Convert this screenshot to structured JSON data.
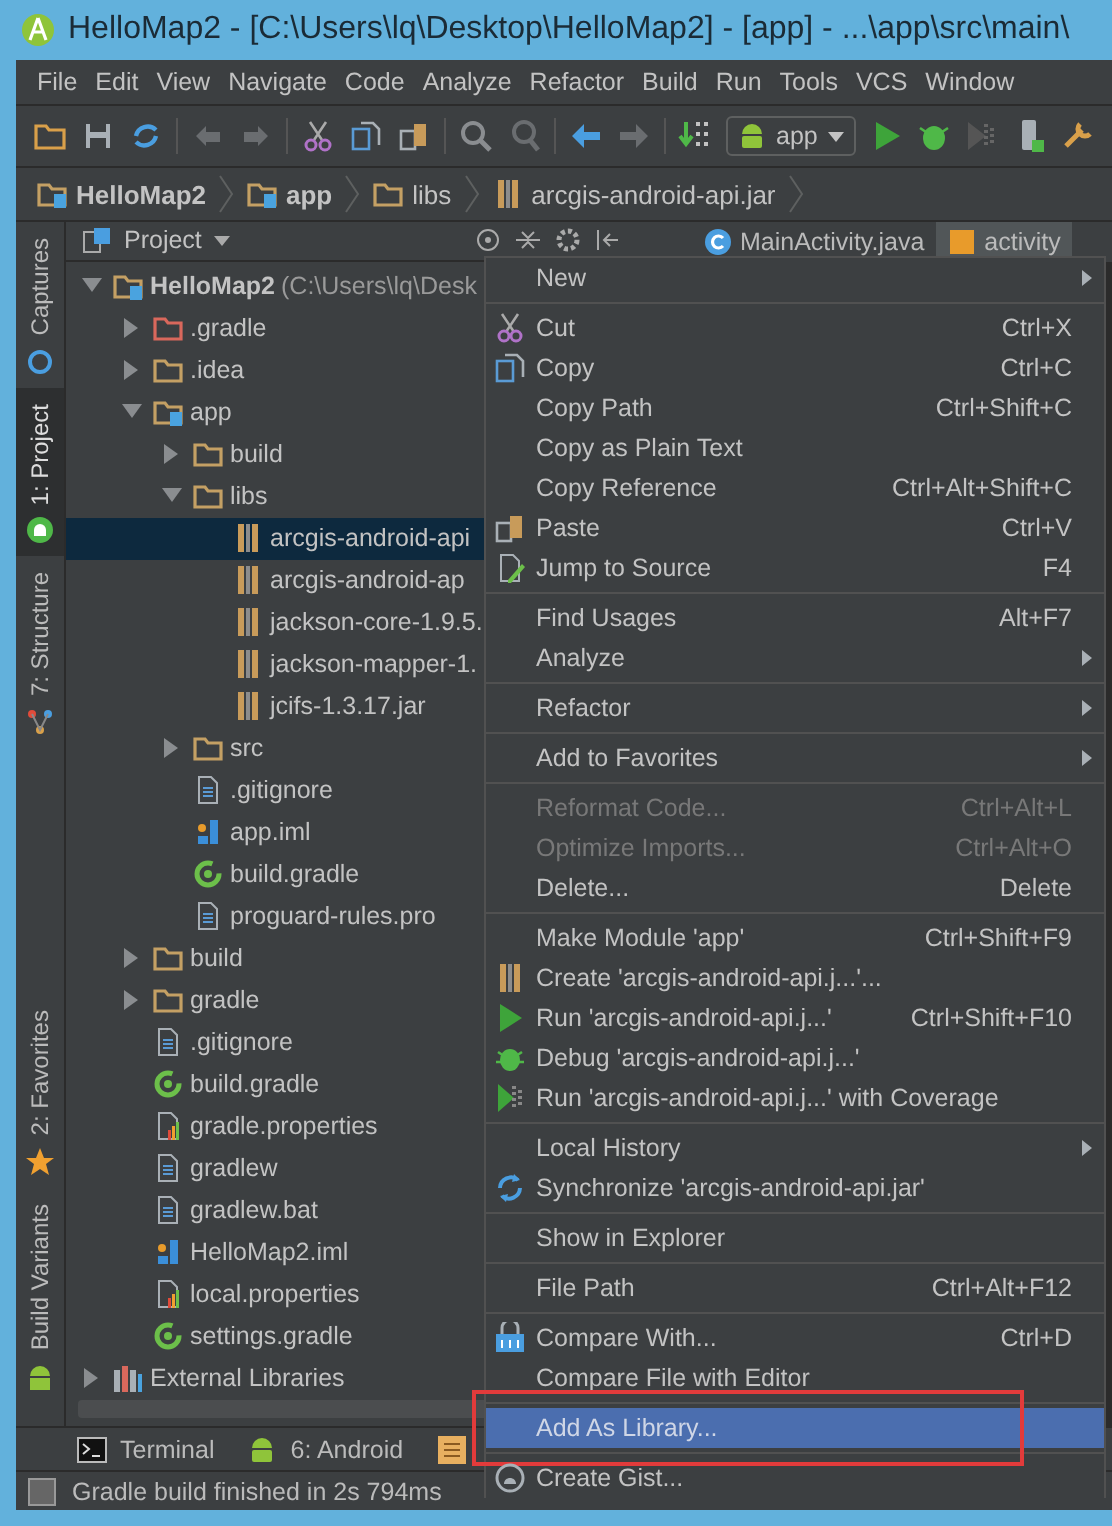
{
  "window": {
    "title": "HelloMap2 - [C:\\Users\\lq\\Desktop\\HelloMap2] - [app] - ...\\app\\src\\main\\"
  },
  "menu_bar": [
    "File",
    "Edit",
    "View",
    "Navigate",
    "Code",
    "Analyze",
    "Refactor",
    "Build",
    "Run",
    "Tools",
    "VCS",
    "Window"
  ],
  "toolbar": {
    "run_config": "app"
  },
  "breadcrumbs": [
    {
      "label": "HelloMap2",
      "kind": "module"
    },
    {
      "label": "app",
      "kind": "module"
    },
    {
      "label": "libs",
      "kind": "folder"
    },
    {
      "label": "arcgis-android-api.jar",
      "kind": "jar"
    }
  ],
  "tool_strip": {
    "top": [
      {
        "label": "Captures",
        "selected": false
      },
      {
        "label": "1: Project",
        "selected": true
      },
      {
        "label": "7: Structure",
        "selected": false
      }
    ],
    "bottom": [
      {
        "label": "2: Favorites",
        "selected": false
      },
      {
        "label": "Build Variants",
        "selected": false
      }
    ]
  },
  "project_panel": {
    "title": "Project",
    "tree": [
      {
        "label": "HelloMap2",
        "detail": "(C:\\Users\\lq\\Desk",
        "kind": "module",
        "expanded": true,
        "selected": false,
        "children": [
          {
            "label": ".gradle",
            "kind": "excluded-folder",
            "expanded": false,
            "selected": false
          },
          {
            "label": ".idea",
            "kind": "folder",
            "expanded": false,
            "selected": false
          },
          {
            "label": "app",
            "kind": "module",
            "expanded": true,
            "selected": false,
            "children": [
              {
                "label": "build",
                "kind": "folder",
                "expanded": false,
                "selected": false
              },
              {
                "label": "libs",
                "kind": "folder",
                "expanded": true,
                "selected": false,
                "children": [
                  {
                    "label": "arcgis-android-api",
                    "kind": "jar",
                    "selected": true
                  },
                  {
                    "label": "arcgis-android-ap",
                    "kind": "jar",
                    "selected": false
                  },
                  {
                    "label": "jackson-core-1.9.5.",
                    "kind": "jar",
                    "selected": false
                  },
                  {
                    "label": "jackson-mapper-1.",
                    "kind": "jar",
                    "selected": false
                  },
                  {
                    "label": "jcifs-1.3.17.jar",
                    "kind": "jar",
                    "selected": false
                  }
                ]
              },
              {
                "label": "src",
                "kind": "folder",
                "expanded": false,
                "selected": false
              },
              {
                "label": ".gitignore",
                "kind": "text",
                "selected": false
              },
              {
                "label": "app.iml",
                "kind": "iml",
                "selected": false
              },
              {
                "label": "build.gradle",
                "kind": "gradle",
                "selected": false
              },
              {
                "label": "proguard-rules.pro",
                "kind": "text",
                "selected": false
              }
            ]
          },
          {
            "label": "build",
            "kind": "folder",
            "expanded": false,
            "selected": false
          },
          {
            "label": "gradle",
            "kind": "folder",
            "expanded": false,
            "selected": false
          },
          {
            "label": ".gitignore",
            "kind": "text",
            "selected": false
          },
          {
            "label": "build.gradle",
            "kind": "gradle",
            "selected": false
          },
          {
            "label": "gradle.properties",
            "kind": "properties",
            "selected": false
          },
          {
            "label": "gradlew",
            "kind": "text",
            "selected": false
          },
          {
            "label": "gradlew.bat",
            "kind": "text",
            "selected": false
          },
          {
            "label": "HelloMap2.iml",
            "kind": "iml",
            "selected": false
          },
          {
            "label": "local.properties",
            "kind": "properties",
            "selected": false
          },
          {
            "label": "settings.gradle",
            "kind": "gradle",
            "selected": false
          }
        ]
      },
      {
        "label": "External Libraries",
        "kind": "libraries",
        "expanded": false,
        "selected": false
      }
    ]
  },
  "editor_tabs": [
    {
      "label": "MainActivity.java",
      "selected": false
    },
    {
      "label": "activity",
      "selected": true
    }
  ],
  "context_menu": {
    "items": [
      {
        "kind": "item",
        "label": "New",
        "submenu": true,
        "disabled": false,
        "selected": false
      },
      {
        "kind": "separator"
      },
      {
        "kind": "item",
        "label": "Cut",
        "shortcut": "Ctrl+X",
        "disabled": false,
        "selected": false
      },
      {
        "kind": "item",
        "label": "Copy",
        "shortcut": "Ctrl+C",
        "disabled": false,
        "selected": false
      },
      {
        "kind": "item",
        "label": "Copy Path",
        "shortcut": "Ctrl+Shift+C",
        "disabled": false,
        "selected": false
      },
      {
        "kind": "item",
        "label": "Copy as Plain Text",
        "disabled": false,
        "selected": false
      },
      {
        "kind": "item",
        "label": "Copy Reference",
        "shortcut": "Ctrl+Alt+Shift+C",
        "disabled": false,
        "selected": false
      },
      {
        "kind": "item",
        "label": "Paste",
        "shortcut": "Ctrl+V",
        "disabled": false,
        "selected": false
      },
      {
        "kind": "item",
        "label": "Jump to Source",
        "shortcut": "F4",
        "disabled": false,
        "selected": false
      },
      {
        "kind": "separator"
      },
      {
        "kind": "item",
        "label": "Find Usages",
        "shortcut": "Alt+F7",
        "disabled": false,
        "selected": false
      },
      {
        "kind": "item",
        "label": "Analyze",
        "submenu": true,
        "disabled": false,
        "selected": false
      },
      {
        "kind": "separator"
      },
      {
        "kind": "item",
        "label": "Refactor",
        "submenu": true,
        "disabled": false,
        "selected": false
      },
      {
        "kind": "separator"
      },
      {
        "kind": "item",
        "label": "Add to Favorites",
        "submenu": true,
        "disabled": false,
        "selected": false
      },
      {
        "kind": "separator"
      },
      {
        "kind": "item",
        "label": "Reformat Code...",
        "shortcut": "Ctrl+Alt+L",
        "disabled": true,
        "selected": false
      },
      {
        "kind": "item",
        "label": "Optimize Imports...",
        "shortcut": "Ctrl+Alt+O",
        "disabled": true,
        "selected": false
      },
      {
        "kind": "item",
        "label": "Delete...",
        "shortcut": "Delete",
        "disabled": false,
        "selected": false
      },
      {
        "kind": "separator"
      },
      {
        "kind": "item",
        "label": "Make Module 'app'",
        "shortcut": "Ctrl+Shift+F9",
        "disabled": false,
        "selected": false
      },
      {
        "kind": "item",
        "label": "Create 'arcgis-android-api.j...'...",
        "disabled": false,
        "selected": false
      },
      {
        "kind": "item",
        "label": "Run 'arcgis-android-api.j...'",
        "shortcut": "Ctrl+Shift+F10",
        "disabled": false,
        "selected": false
      },
      {
        "kind": "item",
        "label": "Debug 'arcgis-android-api.j...'",
        "disabled": false,
        "selected": false
      },
      {
        "kind": "item",
        "label": "Run 'arcgis-android-api.j...' with Coverage",
        "disabled": false,
        "selected": false
      },
      {
        "kind": "separator"
      },
      {
        "kind": "item",
        "label": "Local History",
        "submenu": true,
        "disabled": false,
        "selected": false
      },
      {
        "kind": "item",
        "label": "Synchronize 'arcgis-android-api.jar'",
        "disabled": false,
        "selected": false
      },
      {
        "kind": "separator"
      },
      {
        "kind": "item",
        "label": "Show in Explorer",
        "disabled": false,
        "selected": false
      },
      {
        "kind": "separator"
      },
      {
        "kind": "item",
        "label": "File Path",
        "shortcut": "Ctrl+Alt+F12",
        "disabled": false,
        "selected": false
      },
      {
        "kind": "separator"
      },
      {
        "kind": "item",
        "label": "Compare With...",
        "shortcut": "Ctrl+D",
        "disabled": false,
        "selected": false
      },
      {
        "kind": "item",
        "label": "Compare File with Editor",
        "disabled": false,
        "selected": false
      },
      {
        "kind": "separator"
      },
      {
        "kind": "item",
        "label": "Add As Library...",
        "disabled": false,
        "selected": true,
        "annotated": true
      },
      {
        "kind": "separator"
      },
      {
        "kind": "item",
        "label": "Create Gist...",
        "disabled": false,
        "selected": false
      }
    ]
  },
  "bottom_tabs": [
    {
      "label": "Terminal",
      "kind": "terminal"
    },
    {
      "label": "6: Android",
      "kind": "android"
    }
  ],
  "status_bar": {
    "message": "Gradle build finished in 2s 794ms"
  }
}
